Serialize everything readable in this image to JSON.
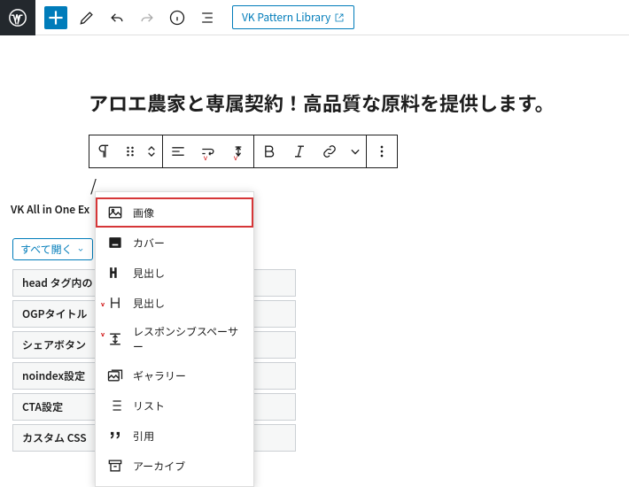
{
  "topbar": {
    "pattern_library_label": "VK Pattern Library"
  },
  "page_title": "アロエ農家と専属契約！高品質な原料を提供します。",
  "empty_block_marker": "/",
  "panel": {
    "label": "VK All in One Ex",
    "expand_label": "すべて開く",
    "items": [
      "head タグ内の",
      "OGPタイトル",
      "シェアボタン",
      "noindex設定",
      "CTA設定",
      "カスタム CSS"
    ]
  },
  "dropdown": {
    "items": [
      {
        "label": "画像"
      },
      {
        "label": "カバー"
      },
      {
        "label": "見出し"
      },
      {
        "label": "見出し"
      },
      {
        "label": "レスポンシブスペーサー"
      },
      {
        "label": "ギャラリー"
      },
      {
        "label": "リスト"
      },
      {
        "label": "引用"
      },
      {
        "label": "アーカイブ"
      }
    ]
  }
}
